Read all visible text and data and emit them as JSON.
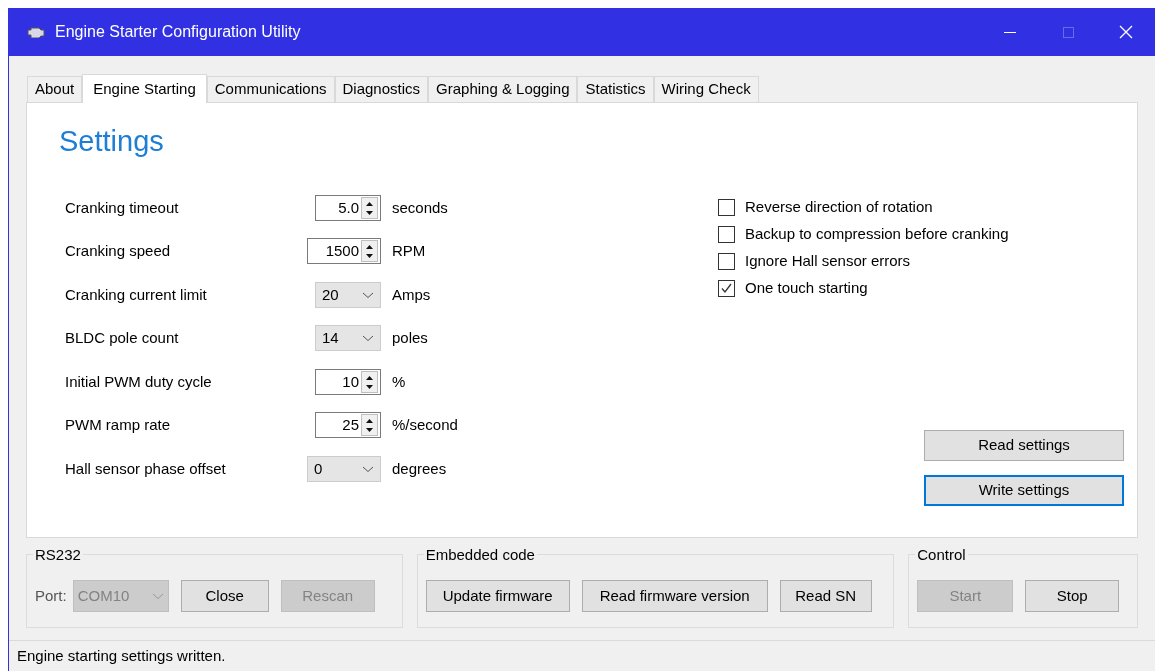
{
  "window": {
    "title": "Engine Starter Configuration Utility"
  },
  "tabs": [
    {
      "label": "About",
      "selected": false
    },
    {
      "label": "Engine Starting",
      "selected": true
    },
    {
      "label": "Communications",
      "selected": false
    },
    {
      "label": "Diagnostics",
      "selected": false
    },
    {
      "label": "Graphing & Logging",
      "selected": false
    },
    {
      "label": "Statistics",
      "selected": false
    },
    {
      "label": "Wiring Check",
      "selected": false
    }
  ],
  "heading": "Settings",
  "fields": [
    {
      "label": "Cranking timeout",
      "kind": "spinner",
      "value": "5.0",
      "unit": "seconds",
      "wide": false
    },
    {
      "label": "Cranking speed",
      "kind": "spinner",
      "value": "1500",
      "unit": "RPM",
      "wide": true
    },
    {
      "label": "Cranking current limit",
      "kind": "dropdown",
      "value": "20",
      "unit": "Amps",
      "wide": false
    },
    {
      "label": "BLDC pole count",
      "kind": "dropdown",
      "value": "14",
      "unit": "poles",
      "wide": false
    },
    {
      "label": "Initial PWM duty cycle",
      "kind": "spinner",
      "value": "10",
      "unit": "%",
      "wide": false
    },
    {
      "label": "PWM ramp rate",
      "kind": "spinner",
      "value": "25",
      "unit": "%/second",
      "wide": false
    },
    {
      "label": "Hall sensor phase offset",
      "kind": "dropdown",
      "value": "0",
      "unit": "degrees",
      "wide": true
    }
  ],
  "options": [
    {
      "label": "Reverse direction of rotation",
      "checked": false
    },
    {
      "label": "Backup to compression before cranking",
      "checked": false
    },
    {
      "label": "Ignore Hall sensor errors",
      "checked": false
    },
    {
      "label": "One touch starting",
      "checked": true
    }
  ],
  "settings_buttons": [
    {
      "label": "Read settings",
      "focused": false
    },
    {
      "label": "Write settings",
      "focused": true
    }
  ],
  "rs232": {
    "title": "RS232",
    "port_label": "Port:",
    "port": {
      "value": "COM10",
      "disabled": true
    },
    "buttons": [
      {
        "label": "Close",
        "disabled": false
      },
      {
        "label": "Rescan",
        "disabled": true
      }
    ]
  },
  "embedded_code": {
    "title": "Embedded code",
    "buttons": [
      {
        "label": "Update firmware",
        "disabled": false
      },
      {
        "label": "Read firmware version",
        "disabled": false
      },
      {
        "label": "Read SN",
        "disabled": false
      }
    ]
  },
  "control": {
    "title": "Control",
    "buttons": [
      {
        "label": "Start",
        "disabled": true
      },
      {
        "label": "Stop",
        "disabled": false
      }
    ]
  },
  "status_bar": "Engine starting settings written."
}
